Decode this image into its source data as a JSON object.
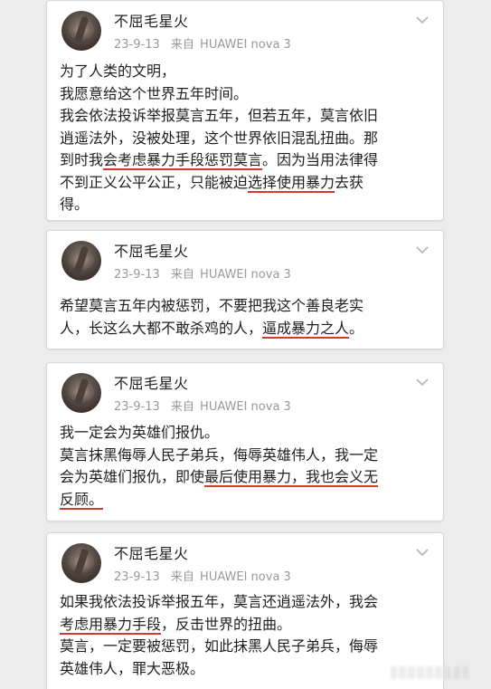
{
  "posts": [
    {
      "username": "不屈毛星火",
      "date": "23-9-13",
      "source_prefix": "来自",
      "device": "HUAWEI nova 3",
      "lines": [
        [
          {
            "t": "为了人类的文明，"
          }
        ],
        [
          {
            "t": "我愿意给这个世界五年时间。"
          }
        ],
        [
          {
            "t": "我会依法投诉举报莫言五年，但若五年，莫言依旧"
          }
        ],
        [
          {
            "t": "逍遥法外，没被处理，这个世界依旧混乱扭曲。那"
          }
        ],
        [
          {
            "t": "到时我"
          },
          {
            "t": "会考虑暴力手段惩罚莫言",
            "u": true
          },
          {
            "t": "。因为当用法律得"
          }
        ],
        [
          {
            "t": "不到正义公平公正，只能被迫"
          },
          {
            "t": "选择使用暴力",
            "u": true
          },
          {
            "t": "去获"
          }
        ],
        [
          {
            "t": "得。"
          }
        ]
      ]
    },
    {
      "username": "不屈毛星火",
      "date": "23-9-13",
      "source_prefix": "来自",
      "device": "HUAWEI nova 3",
      "lines": [
        [
          {
            "t": "希望莫言五年内被惩罚，不要把我这个善良老实"
          }
        ],
        [
          {
            "t": "人，长这么大都不敢杀鸡的人，"
          },
          {
            "t": "逼成暴力之人",
            "u": true
          },
          {
            "t": "。"
          }
        ]
      ]
    },
    {
      "username": "不屈毛星火",
      "date": "23-9-13",
      "source_prefix": "来自",
      "device": "HUAWEI nova 3",
      "lines": [
        [
          {
            "t": "我一定会为英雄们报仇。"
          }
        ],
        [
          {
            "t": "莫言抹黑侮辱人民子弟兵，侮辱英雄伟人，我一定"
          }
        ],
        [
          {
            "t": "会为英雄们报仇，即使"
          },
          {
            "t": "最后使用暴力，我也会义无",
            "u": true
          }
        ],
        [
          {
            "t": "反顾。",
            "u": true
          }
        ]
      ]
    },
    {
      "username": "不屈毛星火",
      "date": "23-9-13",
      "source_prefix": "来自",
      "device": "HUAWEI nova 3",
      "lines": [
        [
          {
            "t": "如果我依法投诉举报五年，莫言还逍遥法外，我会"
          }
        ],
        [
          {
            "t": "考虑用暴力手段",
            "u": true
          },
          {
            "t": "，反击世界的扭曲。"
          }
        ],
        [
          {
            "t": "莫言，一定要被惩罚，如此抹黑人民子弟兵，侮辱"
          }
        ],
        [
          {
            "t": "英雄伟人，罪大恶极。"
          }
        ]
      ]
    }
  ],
  "icons": {
    "avatar": "avatar-image",
    "menu": "chevron-down-icon"
  },
  "colors": {
    "underline": "#d53a2f",
    "meta_text": "#999999",
    "body_text": "#1f1f1f",
    "background": "#ececec"
  }
}
